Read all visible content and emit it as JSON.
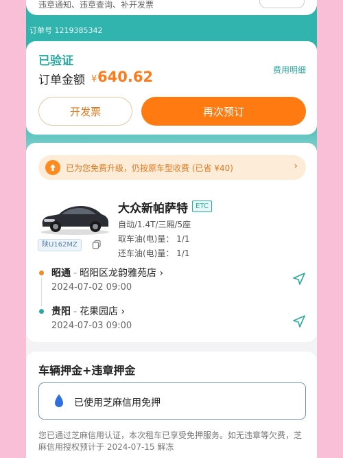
{
  "top_card": {
    "notice_text": "违章通知、违章查询、补开发票"
  },
  "order": {
    "number_label": "订单号 1219385342"
  },
  "status": {
    "verified_label": "已验证",
    "amount_label": "订单金额",
    "currency": "¥",
    "amount": "640.62",
    "fee_detail_label": "费用明细",
    "invoice_button": "开发票",
    "rebook_button": "再次预订"
  },
  "upgrade": {
    "text": "已为您免费升级，仍按原车型收费 (已省 ¥40)",
    "arrow": "›"
  },
  "car": {
    "name": "大众新帕萨特",
    "etc_tag": "ETC",
    "spec": "自动/1.4T/三厢/5座",
    "fuel_pickup": "取车油(电)量： 1/1",
    "fuel_return": "还车油(电)量： 1/1",
    "plate": "陕U162MZ"
  },
  "pickup": {
    "city": "昭通",
    "store": "昭阳区龙韵雅苑店",
    "time": "2024-07-02 09:00"
  },
  "return": {
    "city": "贵阳",
    "store": "花果园店",
    "time": "2024-07-03 09:00"
  },
  "deposit": {
    "title": "车辆押金+违章押金",
    "credit_text": "已使用芝麻信用免押",
    "desc": "您已通过芝麻信用认证，本次租车已享受免押服务。如无违章等欠费，芝麻信用授权预计于 2024-07-15 解冻"
  },
  "colors": {
    "teal": "#2fb3ac",
    "orange": "#ff7a10",
    "pink_bg": "#f8bfd6"
  }
}
